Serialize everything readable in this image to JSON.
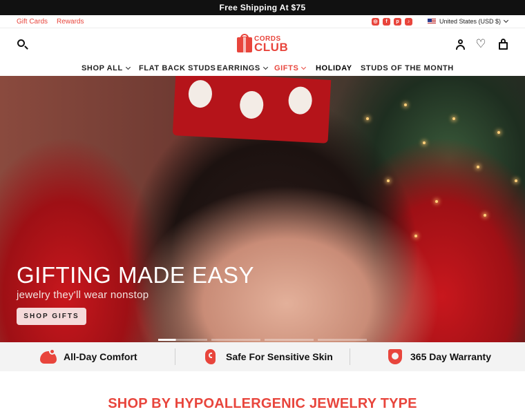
{
  "announcement": "Free Shipping At $75",
  "utility": {
    "links": [
      "Gift Cards",
      "Rewards"
    ],
    "social": [
      {
        "icon": "instagram-icon",
        "glyph": "◎"
      },
      {
        "icon": "facebook-icon",
        "glyph": "f"
      },
      {
        "icon": "pinterest-icon",
        "glyph": "p"
      },
      {
        "icon": "tiktok-icon",
        "glyph": "♪"
      }
    ],
    "country": "United States (USD $)"
  },
  "logo": {
    "line1": "CORDS",
    "line2": "CLUB"
  },
  "header_icons": {
    "wishlist": "♡"
  },
  "nav": [
    {
      "label": "SHOP ALL",
      "dropdown": true
    },
    {
      "label": "FLAT BACK STUDS",
      "dropdown": false
    },
    {
      "label": "EARRINGS",
      "dropdown": true
    },
    {
      "label": "GIFTS",
      "dropdown": true,
      "accent": true
    },
    {
      "label": "HOLIDAY",
      "dropdown": false,
      "bold": true
    },
    {
      "label": "STUDS OF THE MONTH",
      "dropdown": false
    }
  ],
  "hero": {
    "title": "GIFTING MADE EASY",
    "subtitle": "jewelry they'll wear nonstop",
    "cta": "SHOP GIFTS",
    "slides": 4,
    "active_slide": 1
  },
  "perks": [
    {
      "label": "All-Day Comfort",
      "icon": "comfort-icon"
    },
    {
      "label": "Safe For Sensitive Skin",
      "icon": "ear-icon"
    },
    {
      "label": "365 Day Warranty",
      "icon": "warranty-shield-icon"
    }
  ],
  "section_title": "SHOP BY HYPOALLERGENIC JEWELRY TYPE",
  "colors": {
    "accent": "#e8453c",
    "gifts": "#e8453c",
    "announcement_bg": "#111111"
  }
}
